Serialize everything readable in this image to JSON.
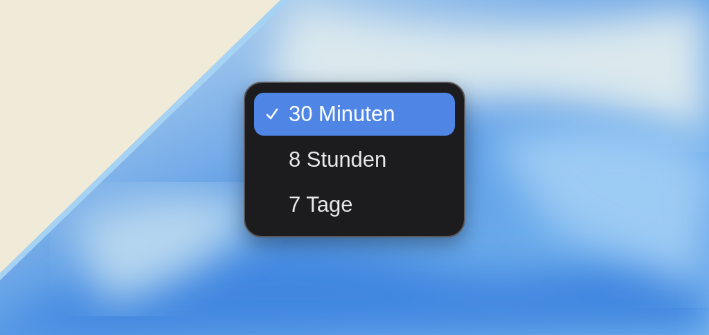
{
  "menu": {
    "items": [
      {
        "label": "30 Minuten",
        "selected": true
      },
      {
        "label": "8 Stunden",
        "selected": false
      },
      {
        "label": "7 Tage",
        "selected": false
      }
    ]
  }
}
